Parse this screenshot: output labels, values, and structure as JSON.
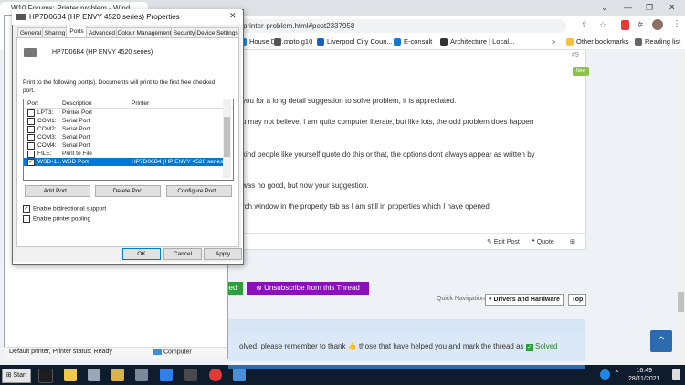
{
  "browser": {
    "tab_title": "W10 Forums: Printer problem - Wind...",
    "url": "printer-problem.html#post2337958",
    "bookmarks": [
      {
        "label": "House Def...",
        "color": "#1e88e5"
      },
      {
        "label": "moto g10",
        "color": "#555555"
      },
      {
        "label": "Liverpool City Coun...",
        "color": "#1565c0"
      },
      {
        "label": "E-consult",
        "color": "#1976d2"
      },
      {
        "label": "Architecture | Local...",
        "color": "#333333"
      }
    ],
    "other_bookmarks": "Other bookmarks",
    "reading_list": "Reading list"
  },
  "post": {
    "number": "#9",
    "badge": "New",
    "lines": [
      "you for a long detail suggestion to solve problem, it is appreciated.",
      "u may not believe, I am quite computer literate, but like lots, the odd problem does happen",
      "kind people like yourself quote do this or that, the options dont always appear as written by",
      "was no good, but now your suggestion.",
      "rch window in the property tab as I am still in properties which I have opened"
    ],
    "edit_post": "Edit Post",
    "quote": "Quote"
  },
  "thread": {
    "green_button": "ed",
    "unsubscribe": "Unsubscribe from this Thread",
    "quick_nav_label": "Quick Navigation",
    "quick_nav_select": "Drivers and Hardware",
    "top_button": "Top",
    "solved_text": "olved, please remember to thank",
    "solved_text2": "those that have helped you and mark the thread as",
    "solved_label": "Solved"
  },
  "explorer": {
    "status": "Default printer, Printer status: Ready",
    "computer_label": "Computer"
  },
  "dialog": {
    "title": "HP7D06B4 (HP ENVY 4520 series) Properties",
    "tabs": [
      "General",
      "Sharing",
      "Ports",
      "Advanced",
      "Colour Management",
      "Security",
      "Device Settings"
    ],
    "printer_name": "HP7D06B4 (HP ENVY 4520 series)",
    "instruction": "Print to the following port(s). Documents will print to the first free checked port.",
    "columns": [
      "Port",
      "Description",
      "Printer"
    ],
    "ports": [
      {
        "port": "LPT3:",
        "description": "Printer Port",
        "printer": "",
        "checked": false,
        "selected": false
      },
      {
        "port": "COM1:",
        "description": "Serial Port",
        "printer": "",
        "checked": false,
        "selected": false
      },
      {
        "port": "COM2:",
        "description": "Serial Port",
        "printer": "",
        "checked": false,
        "selected": false
      },
      {
        "port": "COM3:",
        "description": "Serial Port",
        "printer": "",
        "checked": false,
        "selected": false
      },
      {
        "port": "COM4:",
        "description": "Serial Port",
        "printer": "",
        "checked": false,
        "selected": false
      },
      {
        "port": "FILE:",
        "description": "Print to File",
        "printer": "",
        "checked": false,
        "selected": false
      },
      {
        "port": "WSD-1...",
        "description": "WSD Port",
        "printer": "HP7D06B4 (HP ENVY 4520 series)",
        "checked": true,
        "selected": true
      }
    ],
    "add_port": "Add Port...",
    "delete_port": "Delete Port",
    "configure_port": "Configure Port...",
    "bidirectional": "Enable bidirectional support",
    "pooling": "Enable printer pooling",
    "ok": "OK",
    "cancel": "Cancel",
    "apply": "Apply"
  },
  "taskbar": {
    "start": "Start",
    "time": "16:49",
    "date": "28/11/2021"
  }
}
